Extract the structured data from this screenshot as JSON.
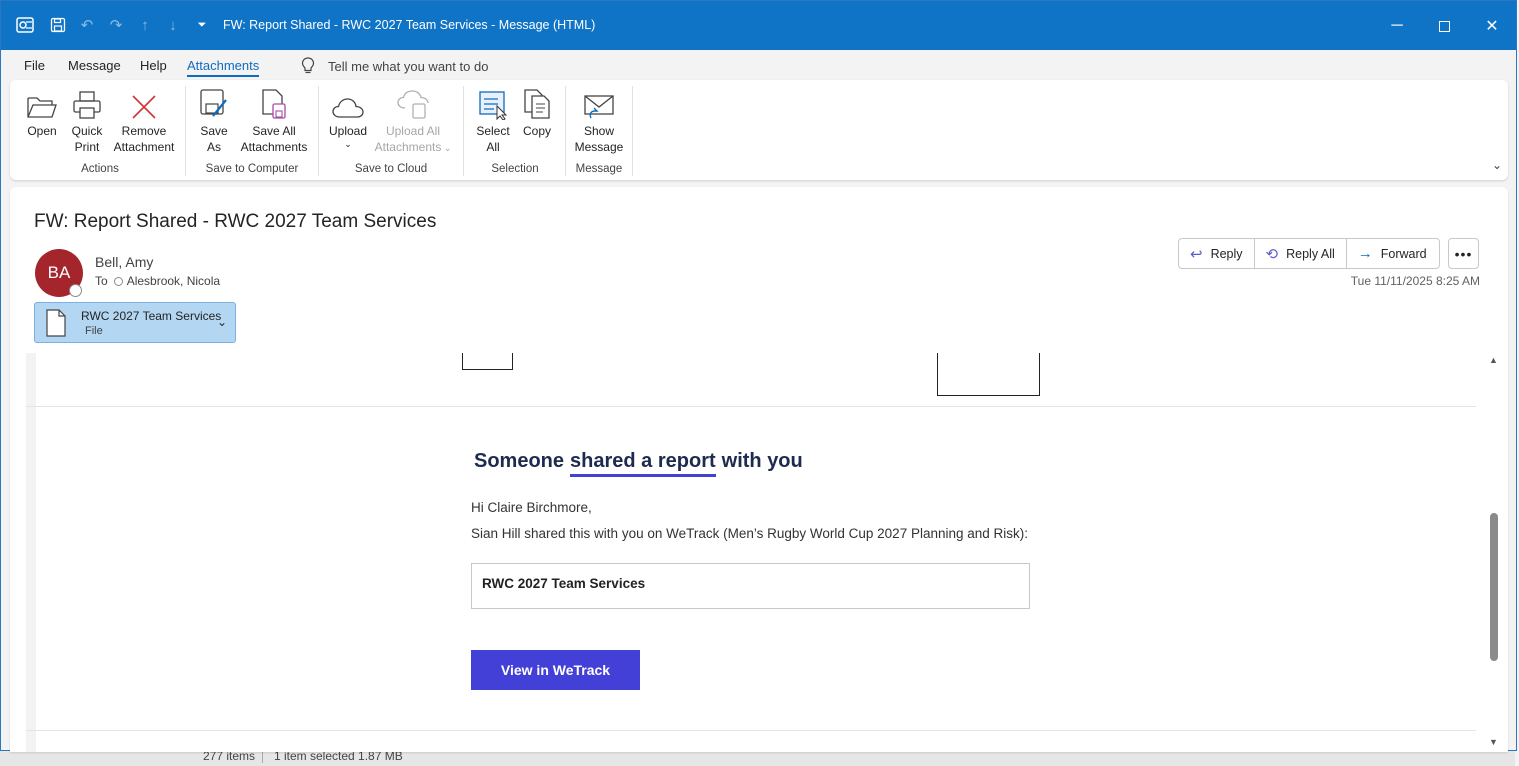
{
  "window": {
    "title": "FW: Report Shared - RWC 2027 Team Services  -  Message (HTML)"
  },
  "menu": {
    "tabs": [
      "File",
      "Message",
      "Help",
      "Attachments"
    ],
    "active_tab": "Attachments",
    "tell_me": "Tell me what you want to do"
  },
  "ribbon": {
    "groups": {
      "actions": "Actions",
      "save_to_computer": "Save to Computer",
      "save_to_cloud": "Save to Cloud",
      "selection": "Selection",
      "message": "Message"
    },
    "buttons": {
      "open": "Open",
      "quick_print_1": "Quick",
      "quick_print_2": "Print",
      "remove_1": "Remove",
      "remove_2": "Attachment",
      "save_as_1": "Save",
      "save_as_2": "As",
      "save_all_1": "Save All",
      "save_all_2": "Attachments",
      "upload": "Upload",
      "upload_all_1": "Upload All",
      "upload_all_2": "Attachments",
      "select_all_1": "Select",
      "select_all_2": "All",
      "copy": "Copy",
      "show_message_1": "Show",
      "show_message_2": "Message"
    },
    "upload_all_disabled": true
  },
  "message": {
    "subject": "FW: Report Shared - RWC 2027 Team Services",
    "avatar_initials": "BA",
    "avatar_color": "#a4262c",
    "sender": "Bell, Amy",
    "to_label": "To",
    "recipient": "Alesbrook, Nicola",
    "datetime": "Tue 11/11/2025 8:25 AM",
    "actions": {
      "reply": "Reply",
      "reply_all": "Reply All",
      "forward": "Forward"
    },
    "attachment": {
      "name": "RWC 2027 Team Services",
      "type": "File"
    }
  },
  "email_body": {
    "headline_1": "Someone",
    "headline_2": "shared a report",
    "headline_3": "with you",
    "greeting": "Hi Claire Birchmore,",
    "shared_line": "Sian Hill shared this with you on WeTrack (Men’s Rugby World Cup 2027 Planning and Risk):",
    "report_name": "RWC 2027 Team Services",
    "cta": "View in WeTrack",
    "accent_color": "#4340d8"
  },
  "background_status": {
    "items": "277 items",
    "selection": "1 item selected  1.87 MB"
  }
}
